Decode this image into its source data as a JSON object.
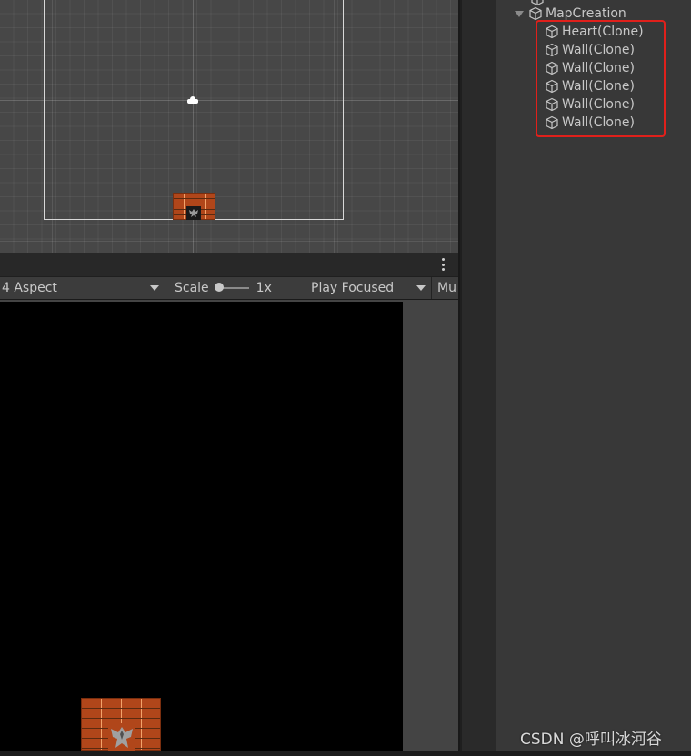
{
  "game_toolbar": {
    "aspect_label": "4 Aspect",
    "scale_label": "Scale",
    "scale_value": "1x",
    "scale_level": 0.0,
    "play_mode_label": "Play Focused",
    "mute_label": "Mu"
  },
  "hierarchy": {
    "parent": "MapCreation",
    "children": [
      {
        "label": "Heart(Clone)"
      },
      {
        "label": "Wall(Clone)"
      },
      {
        "label": "Wall(Clone)"
      },
      {
        "label": "Wall(Clone)"
      },
      {
        "label": "Wall(Clone)"
      },
      {
        "label": "Wall(Clone)"
      }
    ]
  },
  "watermark": "CSDN @呼叫冰河谷",
  "colors": {
    "scene_background": "#474747",
    "game_background": "#000000",
    "hierarchy_background": "#383838",
    "highlight_border": "#e0201b",
    "brick": "#b0461a"
  },
  "icons": {
    "gameobject": "cube-icon",
    "options": "kebab-icon",
    "camera": "camera-gizmo-icon"
  }
}
